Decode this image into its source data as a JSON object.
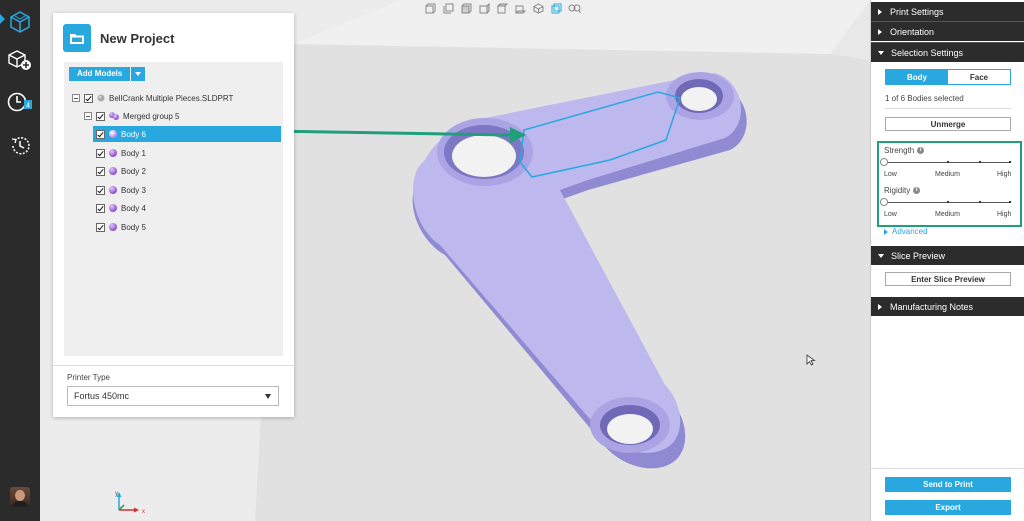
{
  "rail": {
    "items": [
      "cube-icon",
      "add-model-icon",
      "clock-badge-icon",
      "history-icon"
    ],
    "badge_count": "4"
  },
  "toolbar": {
    "icons": [
      "view-front-icon",
      "view-back-icon",
      "view-left-icon",
      "view-right-icon",
      "view-top-icon",
      "view-bottom-icon",
      "view-iso-icon",
      "view-wire-icon",
      "zoom-fit-icon"
    ]
  },
  "project": {
    "title": "New Project",
    "add_models_label": "Add Models",
    "tree": {
      "file": "BellCrank Multiple Pieces.SLDPRT",
      "group": "Merged group 5",
      "bodies": [
        "Body 6",
        "Body 1",
        "Body 2",
        "Body 3",
        "Body 4",
        "Body 5"
      ],
      "selected": "Body 6"
    },
    "printer_type_label": "Printer Type",
    "printer_type_value": "Fortus 450mc"
  },
  "right_panel": {
    "sections": {
      "print_settings": "Print Settings",
      "orientation": "Orientation",
      "selection_settings": "Selection Settings",
      "slice_preview": "Slice Preview",
      "manufacturing_notes": "Manufacturing Notes"
    },
    "selection": {
      "mode_body": "Body",
      "mode_face": "Face",
      "active_mode": "Body",
      "status": "1 of 6 Bodies selected",
      "unmerge_label": "Unmerge",
      "strength_label": "Strength",
      "rigidity_label": "Rigidity",
      "scale_low": "Low",
      "scale_medium": "Medium",
      "scale_high": "High",
      "strength_level": 0,
      "rigidity_level": 0,
      "advanced_label": "Advanced"
    },
    "slice": {
      "enter_label": "Enter Slice Preview"
    },
    "actions": {
      "send_label": "Send to Print",
      "export_label": "Export"
    }
  },
  "axes": {
    "x": "x",
    "y": "y"
  },
  "colors": {
    "accent": "#29a8e0",
    "model": "#b8b4e8",
    "highlight": "#1fa07b",
    "dark": "#2c2c2c"
  }
}
